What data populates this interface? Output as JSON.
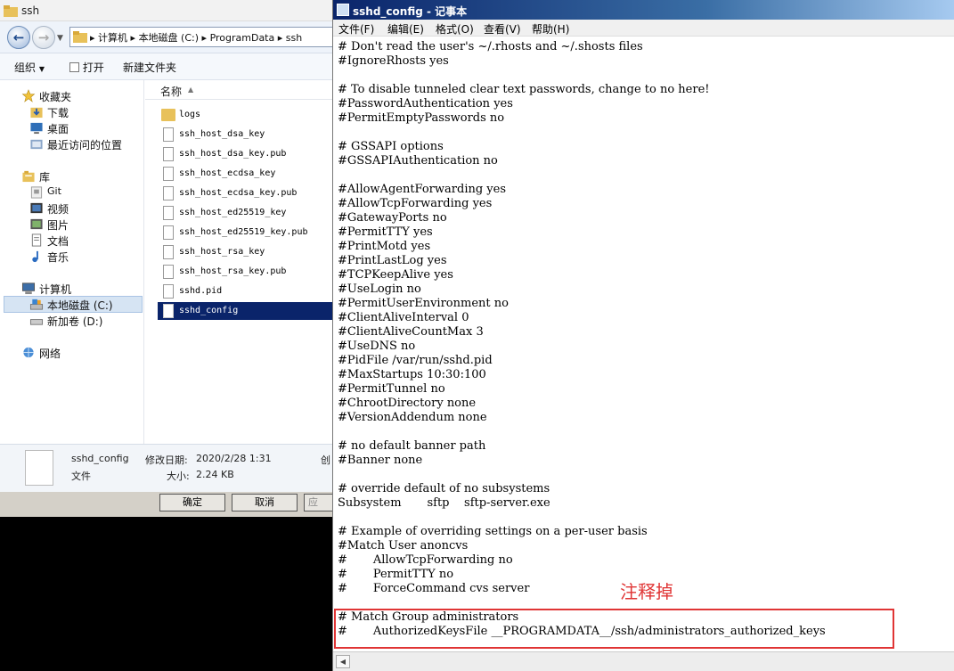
{
  "explorer": {
    "title": "ssh",
    "address": {
      "crumbs": [
        "计算机",
        "本地磁盘 (C:)",
        "ProgramData",
        "ssh"
      ],
      "separator": "▸"
    },
    "toolbar": {
      "organize": "组织",
      "open": "打开",
      "new_folder": "新建文件夹"
    },
    "nav": {
      "favorites": "收藏夹",
      "downloads": "下载",
      "desktop": "桌面",
      "recent": "最近访问的位置",
      "libraries": "库",
      "git": "Git",
      "videos": "视频",
      "pictures": "图片",
      "documents": "文档",
      "music": "音乐",
      "computer": "计算机",
      "local_disk": "本地磁盘 (C:)",
      "new_volume": "新加卷 (D:)",
      "network": "网络"
    },
    "column_name": "名称",
    "files": [
      {
        "name": "logs",
        "type": "folder"
      },
      {
        "name": "ssh_host_dsa_key",
        "type": "file"
      },
      {
        "name": "ssh_host_dsa_key.pub",
        "type": "file"
      },
      {
        "name": "ssh_host_ecdsa_key",
        "type": "file"
      },
      {
        "name": "ssh_host_ecdsa_key.pub",
        "type": "file"
      },
      {
        "name": "ssh_host_ed25519_key",
        "type": "file"
      },
      {
        "name": "ssh_host_ed25519_key.pub",
        "type": "file"
      },
      {
        "name": "ssh_host_rsa_key",
        "type": "file"
      },
      {
        "name": "ssh_host_rsa_key.pub",
        "type": "file"
      },
      {
        "name": "sshd.pid",
        "type": "file"
      },
      {
        "name": "sshd_config",
        "type": "file",
        "selected": true
      }
    ],
    "details": {
      "filename": "sshd_config",
      "modified_label": "修改日期:",
      "modified_value": "2020/2/28 1:31",
      "created_trunc": "创",
      "type_label": "文件",
      "size_label": "大小:",
      "size_value": "2.24 KB"
    },
    "dialog": {
      "ok": "确定",
      "cancel": "取消",
      "apply_trunc": "应"
    }
  },
  "notepad": {
    "title": "sshd_config - 记事本",
    "menu": [
      "文件(F)",
      "编辑(E)",
      "格式(O)",
      "查看(V)",
      "帮助(H)"
    ],
    "lines": [
      "# Don't read the user's ~/.rhosts and ~/.shosts files",
      "#IgnoreRhosts yes",
      "",
      "# To disable tunneled clear text passwords, change to no here!",
      "#PasswordAuthentication yes",
      "#PermitEmptyPasswords no",
      "",
      "# GSSAPI options",
      "#GSSAPIAuthentication no",
      "",
      "#AllowAgentForwarding yes",
      "#AllowTcpForwarding yes",
      "#GatewayPorts no",
      "#PermitTTY yes",
      "#PrintMotd yes",
      "#PrintLastLog yes",
      "#TCPKeepAlive yes",
      "#UseLogin no",
      "#PermitUserEnvironment no",
      "#ClientAliveInterval 0",
      "#ClientAliveCountMax 3",
      "#UseDNS no",
      "#PidFile /var/run/sshd.pid",
      "#MaxStartups 10:30:100",
      "#PermitTunnel no",
      "#ChrootDirectory none",
      "#VersionAddendum none",
      "",
      "# no default banner path",
      "#Banner none",
      "",
      "# override default of no subsystems",
      "Subsystem       sftp    sftp-server.exe",
      "",
      "# Example of overriding settings on a per-user basis",
      "#Match User anoncvs",
      "#       AllowTcpForwarding no",
      "#       PermitTTY no",
      "#       ForceCommand cvs server",
      "",
      "# Match Group administrators",
      "#       AuthorizedKeysFile __PROGRAMDATA__/ssh/administrators_authorized_keys"
    ],
    "annotation": "注释掉",
    "colors": {
      "annotation": "#e03535",
      "title_bar": "#0a246a",
      "selection": "#0a246a"
    }
  }
}
